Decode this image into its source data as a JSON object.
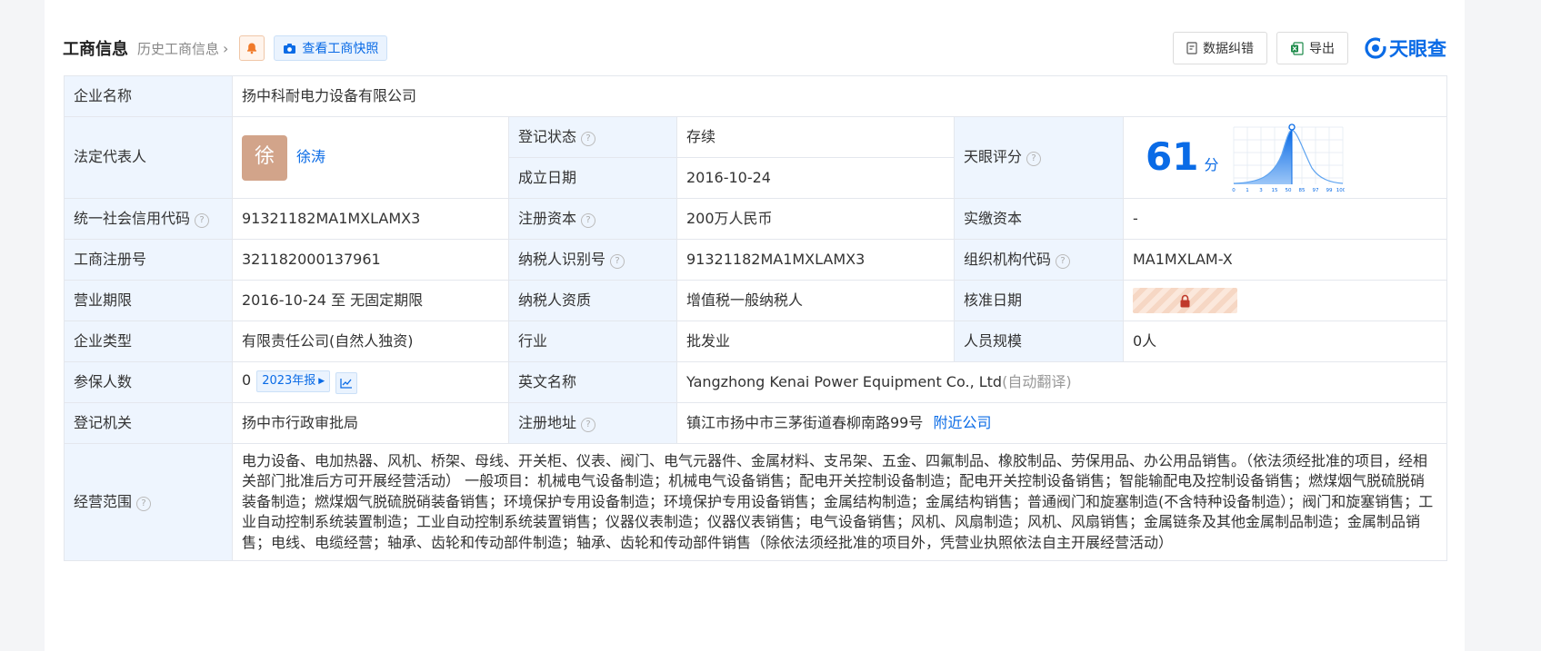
{
  "header": {
    "title": "工商信息",
    "history_link": "历史工商信息",
    "snapshot_button": "查看工商快照",
    "correct_button": "数据纠错",
    "export_button": "导出",
    "brand": "天眼查"
  },
  "company": {
    "name_label": "企业名称",
    "name": "扬中科耐电力设备有限公司",
    "legal_rep_label": "法定代表人",
    "legal_rep_avatar": "徐",
    "legal_rep": "徐涛",
    "status_label": "登记状态",
    "status": "存续",
    "founded_label": "成立日期",
    "founded": "2016-10-24",
    "score_label": "天眼评分",
    "score": "61",
    "score_unit": "分",
    "score_axis": [
      "0",
      "1",
      "3",
      "15",
      "50",
      "85",
      "97",
      "99",
      "100"
    ],
    "credit_code_label": "统一社会信用代码",
    "credit_code": "91321182MA1MXLAMX3",
    "reg_capital_label": "注册资本",
    "reg_capital": "200万人民币",
    "paid_capital_label": "实缴资本",
    "paid_capital": "-",
    "reg_no_label": "工商注册号",
    "reg_no": "321182000137961",
    "taxpayer_id_label": "纳税人识别号",
    "taxpayer_id": "91321182MA1MXLAMX3",
    "org_code_label": "组织机构代码",
    "org_code": "MA1MXLAM-X",
    "term_label": "营业期限",
    "term": "2016-10-24 至 无固定期限",
    "taxpayer_type_label": "纳税人资质",
    "taxpayer_type": "增值税一般纳税人",
    "approve_date_label": "核准日期",
    "company_type_label": "企业类型",
    "company_type": "有限责任公司(自然人独资)",
    "industry_label": "行业",
    "industry": "批发业",
    "staff_label": "人员规模",
    "staff": "0人",
    "insured_label": "参保人数",
    "insured": "0",
    "insured_report": "2023年报",
    "english_name_label": "英文名称",
    "english_name": "Yangzhong Kenai Power Equipment Co., Ltd",
    "english_name_note": "(自动翻译)",
    "authority_label": "登记机关",
    "authority": "扬中市行政审批局",
    "address_label": "注册地址",
    "address": "镇江市扬中市三茅街道春柳南路99号",
    "nearby_link": "附近公司",
    "scope_label": "经营范围",
    "scope": "电力设备、电加热器、风机、桥架、母线、开关柜、仪表、阀门、电气元器件、金属材料、支吊架、五金、四氟制品、橡胶制品、劳保用品、办公用品销售。（依法须经批准的项目，经相关部门批准后方可开展经营活动） 一般项目：机械电气设备制造；机械电气设备销售；配电开关控制设备制造；配电开关控制设备销售；智能输配电及控制设备销售；燃煤烟气脱硫脱硝装备制造；燃煤烟气脱硫脱硝装备销售；环境保护专用设备制造；环境保护专用设备销售；金属结构制造；金属结构销售；普通阀门和旋塞制造(不含特种设备制造）；阀门和旋塞销售；工业自动控制系统装置制造；工业自动控制系统装置销售；仪器仪表制造；仪器仪表销售；电气设备销售；风机、风扇制造；风机、风扇销售；金属链条及其他金属制品制造；金属制品销售；电线、电缆经营；轴承、齿轮和传动部件制造；轴承、齿轮和传动部件销售（除依法须经批准的项目外，凭营业执照依法自主开展经营活动）"
  },
  "colors": {
    "accent": "#0a6be6",
    "status_green": "#119e4d",
    "label_bg": "#eef5fe"
  },
  "icons": {
    "bell": "bell-icon",
    "camera": "camera-icon",
    "doc": "document-icon",
    "excel": "excel-icon",
    "lock": "lock-icon",
    "trend": "trend-chart-icon",
    "question": "help-icon"
  }
}
